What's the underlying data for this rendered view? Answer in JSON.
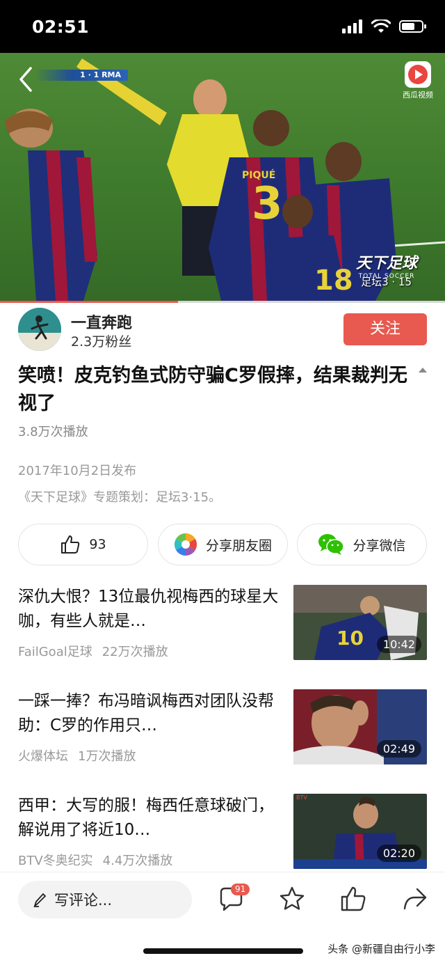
{
  "status_bar": {
    "time": "02:51"
  },
  "video": {
    "score_overlay": "1 · 1 RMA",
    "app_logo_label": "西瓜视频",
    "broadcast_logo": "天下足球",
    "broadcast_logo_sub": "TOTAL SOCCER",
    "broadcast_tag": "足坛3 · 15",
    "progress": 0.4
  },
  "author": {
    "name": "一直奔跑",
    "fans": "2.3万粉丝",
    "follow_label": "关注"
  },
  "article": {
    "title": "笑喷！皮克钓鱼式防守骗C罗假摔，结果裁判无视了",
    "play_count": "3.8万次播放",
    "publish_date": "2017年10月2日发布",
    "description": "《天下足球》专题策划：足坛3·15。"
  },
  "actions": {
    "like_count": "93",
    "share_moments": "分享朋友圈",
    "share_wechat": "分享微信"
  },
  "recommendations": [
    {
      "title": "深仇大恨？13位最仇视梅西的球星大咖，有些人就是…",
      "source": "FailGoal足球",
      "plays": "22万次播放",
      "duration": "10:42"
    },
    {
      "title": "一踩一捧？布冯暗讽梅西对团队没帮助：C罗的作用只…",
      "source": "火爆体坛",
      "plays": "1万次播放",
      "duration": "02:49"
    },
    {
      "title": "西甲：大写的服！梅西任意球破门，解说用了将近10…",
      "source": "BTV冬奥纪实",
      "plays": "4.4万次播放",
      "duration": "02:20"
    }
  ],
  "bottom_bar": {
    "comment_placeholder": "写评论...",
    "comment_badge": "91"
  },
  "watermark": "头条 @新疆自由行小李",
  "colors": {
    "accent": "#e8594f",
    "wechat_green": "#2dc100"
  }
}
